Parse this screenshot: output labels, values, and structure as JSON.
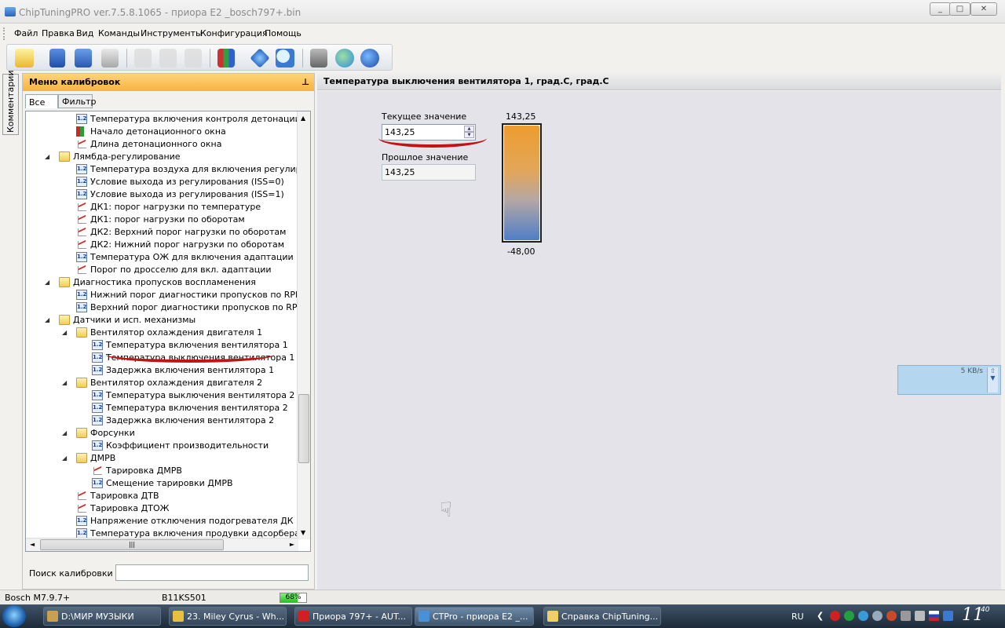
{
  "window": {
    "title": "ChipTuningPRO ver.7.5.8.1065 - приора E2 _bosch797+.bin",
    "min_label": "_",
    "max_label": "□",
    "close_label": "✕"
  },
  "menu": [
    "Файл",
    "Правка",
    "Вид",
    "Команды",
    "Инструменты",
    "Конфигурация",
    "Помощь"
  ],
  "toolbar": {
    "icons": [
      "open-folder-icon",
      "save-icon",
      "save-as-icon",
      "print-icon",
      "copy-icon",
      "paste-icon",
      "undo-icon",
      "chart-icon",
      "info-icon",
      "search-magnifier-icon",
      "tools-icon",
      "globe-icon",
      "help-icon"
    ]
  },
  "left_panel": {
    "title": "Меню калибровок",
    "tab_all": "Все",
    "tab_filter": "Фильтр",
    "search_label": "Поиск калибровки",
    "search_value": "",
    "tree": [
      {
        "label": "Температура включения контроля детонации",
        "icon": "num",
        "level": 2
      },
      {
        "label": "Начало детонационного окна",
        "icon": "bar",
        "level": 2
      },
      {
        "label": "Длина детонационного окна",
        "icon": "graph",
        "level": 2
      },
      {
        "label": "Лямбда-регулирование",
        "icon": "folder",
        "level": 1
      },
      {
        "label": "Температура воздуха для включения регулирован",
        "icon": "num",
        "level": 2
      },
      {
        "label": "Условие выхода из регулирования (ISS=0)",
        "icon": "num",
        "level": 2
      },
      {
        "label": "Условие выхода из регулирования (ISS=1)",
        "icon": "num",
        "level": 2
      },
      {
        "label": "ДК1: порог нагрузки по температуре",
        "icon": "graph",
        "level": 2
      },
      {
        "label": "ДК1: порог нагрузки по оборотам",
        "icon": "graph",
        "level": 2
      },
      {
        "label": "ДК2: Верхний порог нагрузки по оборотам",
        "icon": "graph",
        "level": 2
      },
      {
        "label": "ДК2: Нижний порог нагрузки по оборотам",
        "icon": "graph",
        "level": 2
      },
      {
        "label": "Температура ОЖ для включения адаптации",
        "icon": "num",
        "level": 2
      },
      {
        "label": "Порог по дросселю для вкл. адаптации",
        "icon": "graph",
        "level": 2
      },
      {
        "label": "Диагностика пропусков воспламенения",
        "icon": "folder",
        "level": 1
      },
      {
        "label": "Нижний порог диагностики пропусков по RPM",
        "icon": "num",
        "level": 2
      },
      {
        "label": "Верхний порог диагностики пропусков по RPM",
        "icon": "num",
        "level": 2
      },
      {
        "label": "Датчики и исп. механизмы",
        "icon": "folder",
        "level": 1
      },
      {
        "label": "Вентилятор охлаждения двигателя 1",
        "icon": "folder",
        "level": 2
      },
      {
        "label": "Температура включения вентилятора 1",
        "icon": "num",
        "level": 3
      },
      {
        "label": "Температура выключения вентилятора 1",
        "icon": "num",
        "level": 3
      },
      {
        "label": "Задержка включения вентилятора 1",
        "icon": "num",
        "level": 3
      },
      {
        "label": "Вентилятор охлаждения двигателя 2",
        "icon": "folder",
        "level": 2
      },
      {
        "label": "Температура выключения вентилятора 2",
        "icon": "num",
        "level": 3
      },
      {
        "label": "Температура включения вентилятора 2",
        "icon": "num",
        "level": 3
      },
      {
        "label": "Задержка включения вентилятора 2",
        "icon": "num",
        "level": 3
      },
      {
        "label": "Форсунки",
        "icon": "folder",
        "level": 2
      },
      {
        "label": "Коэффициент производительности",
        "icon": "num",
        "level": 3
      },
      {
        "label": "ДМРВ",
        "icon": "folder",
        "level": 2
      },
      {
        "label": "Тарировка ДМРВ",
        "icon": "graph",
        "level": 3
      },
      {
        "label": "Смещение тарировки ДМРВ",
        "icon": "num",
        "level": 3
      },
      {
        "label": "Тарировка ДТВ",
        "icon": "graph",
        "level": 2
      },
      {
        "label": "Тарировка ДТОЖ",
        "icon": "graph",
        "level": 2
      },
      {
        "label": "Напряжение отключения подогревателя ДК",
        "icon": "num",
        "level": 2
      },
      {
        "label": "Температура включения продувки адсорбера",
        "icon": "num",
        "level": 2
      }
    ]
  },
  "comment_tab": "Комментарии",
  "content": {
    "header": "Температура выключения вентилятора 1, град.С, град.С",
    "current_label": "Текущее значение",
    "current_value": "143,25",
    "previous_label": "Прошлое значение",
    "previous_value": "143,25",
    "gauge_max": "143,25",
    "gauge_min": "-48,00",
    "gauge_level": 1.0
  },
  "speed_widget": {
    "text": "5 KB/s"
  },
  "statusbar": {
    "ecu": "Bosch M7.9.7+",
    "id": "B11KS501",
    "progress_text": "68%",
    "progress": 0.68
  },
  "taskbar": {
    "tasks": [
      {
        "label": "D:\\МИР МУЗЫКИ",
        "icon_color": "#c8a050"
      },
      {
        "label": "23. Miley Cyrus - Wh...",
        "icon_color": "#e8c040"
      },
      {
        "label": "Приора 797+ - AUT...",
        "icon_color": "#d02020"
      },
      {
        "label": "CTPro - приора E2 _...",
        "icon_color": "#4a90d8"
      },
      {
        "label": "Справка ChipTuning...",
        "icon_color": "#f0d060"
      }
    ],
    "lang": "RU",
    "clock": "11",
    "clock_minutes": "40"
  }
}
